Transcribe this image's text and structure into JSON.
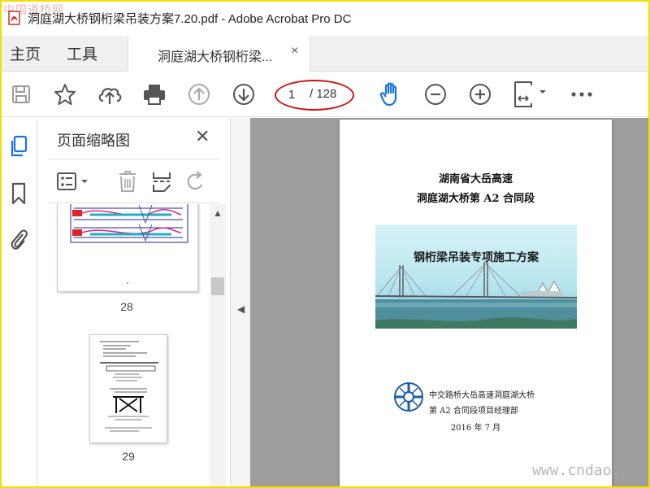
{
  "window": {
    "title": "洞庭湖大桥钢桁梁吊装方案7.20.pdf - Adobe Acrobat Pro DC",
    "watermark_top": "中国道桥网"
  },
  "menu": {
    "home": "主页",
    "tools": "工具"
  },
  "tab": {
    "label": "洞庭湖大桥钢桁梁...",
    "close": "×"
  },
  "toolbar": {
    "current_page": "1",
    "total_pages": "/ 128",
    "icons": [
      "save-icon",
      "bookmark-star-icon",
      "upload-cloud-icon",
      "print-icon",
      "page-up-icon",
      "page-down-icon",
      "hand-tool-icon",
      "zoom-out-icon",
      "zoom-in-icon",
      "fit-page-icon",
      "more-icon"
    ]
  },
  "panel": {
    "title": "页面缩略图",
    "close": "✕",
    "thumbnails": [
      {
        "label": "28"
      },
      {
        "label": "29"
      }
    ]
  },
  "document": {
    "line1": "湖南省大岳高速",
    "line2": "洞庭湖大桥第 A2 合同段",
    "cover_title": "钢桁梁吊装专项施工方案",
    "org_line1": "中交路桥大岳高速洞庭湖大桥",
    "org_line2": "第  A2  合同段项目经理部",
    "date": "2016  年  7  月"
  },
  "watermark_bottom": "www.cndao.",
  "colors": {
    "accent_blue": "#1473e6",
    "highlight_red": "#d01010",
    "frame_yellow": "#f0e000",
    "doc_bg": "#9e9e9e"
  }
}
